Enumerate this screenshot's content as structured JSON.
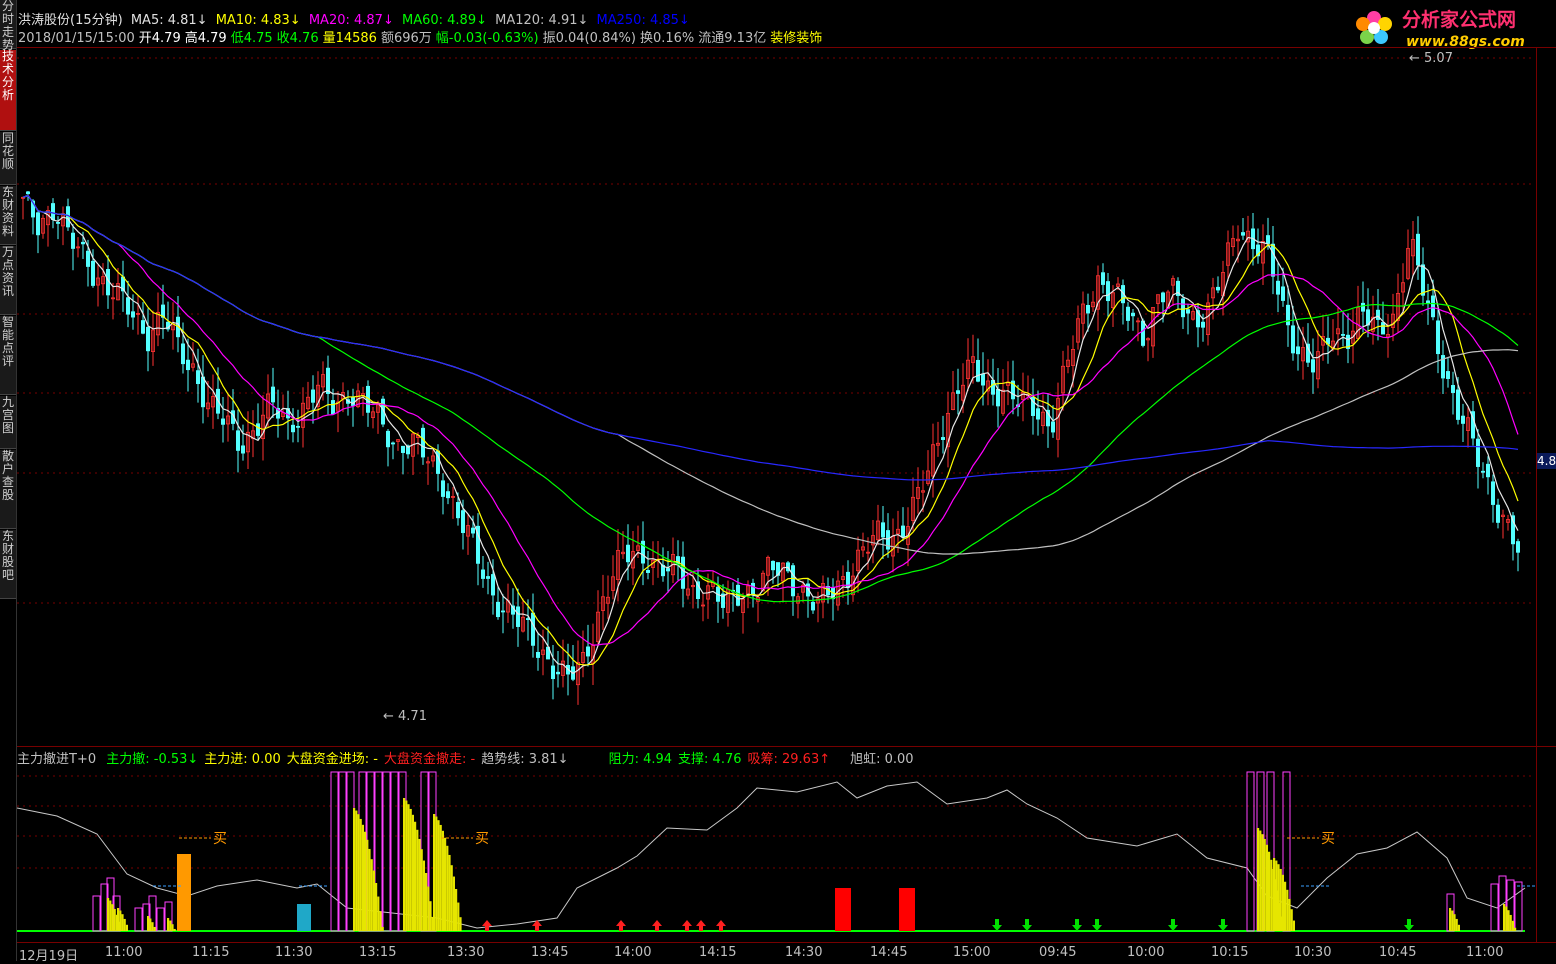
{
  "sidebar": {
    "tabs": [
      {
        "label": "分时走势",
        "active": false
      },
      {
        "label": "技术分析",
        "active": true
      },
      {
        "label": "同花顺",
        "active": false
      },
      {
        "label": "东财资料",
        "active": false
      },
      {
        "label": "万点资讯",
        "active": false
      },
      {
        "label": "智能点评",
        "active": false
      },
      {
        "label": "九宫图",
        "active": false
      },
      {
        "label": "散户查股",
        "active": false
      },
      {
        "label": "东财股吧",
        "active": false
      }
    ]
  },
  "header": {
    "stock": "洪涛股份(15分钟)",
    "ma": [
      {
        "label": "MA5:",
        "value": "4.81",
        "arrow": "↓",
        "color": "#e0e0e0"
      },
      {
        "label": "MA10:",
        "value": "4.83",
        "arrow": "↓",
        "color": "#ffff00"
      },
      {
        "label": "MA20:",
        "value": "4.87",
        "arrow": "↓",
        "color": "#ff00ff"
      },
      {
        "label": "MA60:",
        "value": "4.89",
        "arrow": "↓",
        "color": "#00ff00"
      },
      {
        "label": "MA120:",
        "value": "4.91",
        "arrow": "↓",
        "color": "#c0c0c0"
      },
      {
        "label": "MA250:",
        "value": "4.85",
        "arrow": "↓",
        "color": "#0000ff"
      }
    ],
    "quote": [
      {
        "text": "2018/01/15/15:00",
        "color": "#c0c0c0"
      },
      {
        "text": "开4.79",
        "color": "#ffffff"
      },
      {
        "text": "高4.79",
        "color": "#ffffff"
      },
      {
        "text": "低4.75",
        "color": "#00ff00"
      },
      {
        "text": "收4.76",
        "color": "#00ff00"
      },
      {
        "text": "量14586",
        "color": "#ffff00"
      },
      {
        "text": "额696万",
        "color": "#c0c0c0"
      },
      {
        "text": "幅-0.03(-0.63%)",
        "color": "#00ff00"
      },
      {
        "text": "振0.04(0.84%)",
        "color": "#c0c0c0"
      },
      {
        "text": "换0.16%",
        "color": "#c0c0c0"
      },
      {
        "text": "流通9.13亿",
        "color": "#c0c0c0"
      },
      {
        "text": "装修装饰",
        "color": "#ffff00"
      }
    ]
  },
  "logo": {
    "title": "分析家公式网",
    "url": "www.88gs.com"
  },
  "price_labels": {
    "high": "5.07",
    "low": "4.71",
    "current": "4.8"
  },
  "indicator": {
    "name": "主力撤进T+0",
    "items": [
      {
        "label": "主力撤:",
        "value": "-0.53",
        "arrow": "↓",
        "color": "#00ff00"
      },
      {
        "label": "主力进:",
        "value": "0.00",
        "arrow": "",
        "color": "#ffff00"
      },
      {
        "label": "大盘资金进场:",
        "value": "-",
        "arrow": "",
        "color": "#ffff00"
      },
      {
        "label": "大盘资金撤走:",
        "value": "-",
        "arrow": "",
        "color": "#ff2020"
      },
      {
        "label": "趋势线:",
        "value": "3.81",
        "arrow": "↓",
        "color": "#c0c0c0"
      },
      {
        "label": "阻力:",
        "value": "4.94",
        "arrow": "",
        "color": "#00ff00"
      },
      {
        "label": "支撑:",
        "value": "4.76",
        "arrow": "",
        "color": "#00ff00"
      },
      {
        "label": "吸筹:",
        "value": "29.63",
        "arrow": "↑",
        "color": "#ff2020"
      },
      {
        "label": "旭虹:",
        "value": "0.00",
        "arrow": "",
        "color": "#c0c0c0"
      }
    ],
    "buy_label": "买"
  },
  "time_axis": [
    "12月19日",
    "11:00",
    "11:15",
    "11:30",
    "13:15",
    "13:30",
    "13:45",
    "14:00",
    "14:15",
    "14:30",
    "14:45",
    "15:00",
    "09:45",
    "10:00",
    "10:15",
    "10:30",
    "10:45",
    "11:00"
  ],
  "chart_data": {
    "type": "candlestick",
    "title": "洪涛股份(15分钟)",
    "ylim": [
      4.71,
      5.07
    ],
    "close": [
      4.99,
      4.98,
      4.99,
      4.97,
      4.96,
      4.95,
      4.94,
      4.93,
      4.92,
      4.93,
      4.91,
      4.9,
      4.88,
      4.87,
      4.86,
      4.87,
      4.88,
      4.87,
      4.88,
      4.89,
      4.88,
      4.89,
      4.88,
      4.87,
      4.86,
      4.86,
      4.85,
      4.84,
      4.82,
      4.8,
      4.78,
      4.77,
      4.76,
      4.75,
      4.74,
      4.73,
      4.74,
      4.77,
      4.79,
      4.8,
      4.8,
      4.79,
      4.79,
      4.78,
      4.78,
      4.77,
      4.78,
      4.78,
      4.79,
      4.79,
      4.78,
      4.77,
      4.78,
      4.79,
      4.8,
      4.81,
      4.81,
      4.82,
      4.84,
      4.87,
      4.89,
      4.9,
      4.89,
      4.89,
      4.88,
      4.88,
      4.87,
      4.9,
      4.93,
      4.95,
      4.94,
      4.93,
      4.92,
      4.94,
      4.94,
      4.93,
      4.93,
      4.95,
      4.98,
      4.97,
      4.96,
      4.93,
      4.91,
      4.9,
      4.92,
      4.92,
      4.93,
      4.92,
      4.93,
      4.97,
      4.94,
      4.91,
      4.88,
      4.86,
      4.84,
      4.82,
      4.8
    ]
  }
}
